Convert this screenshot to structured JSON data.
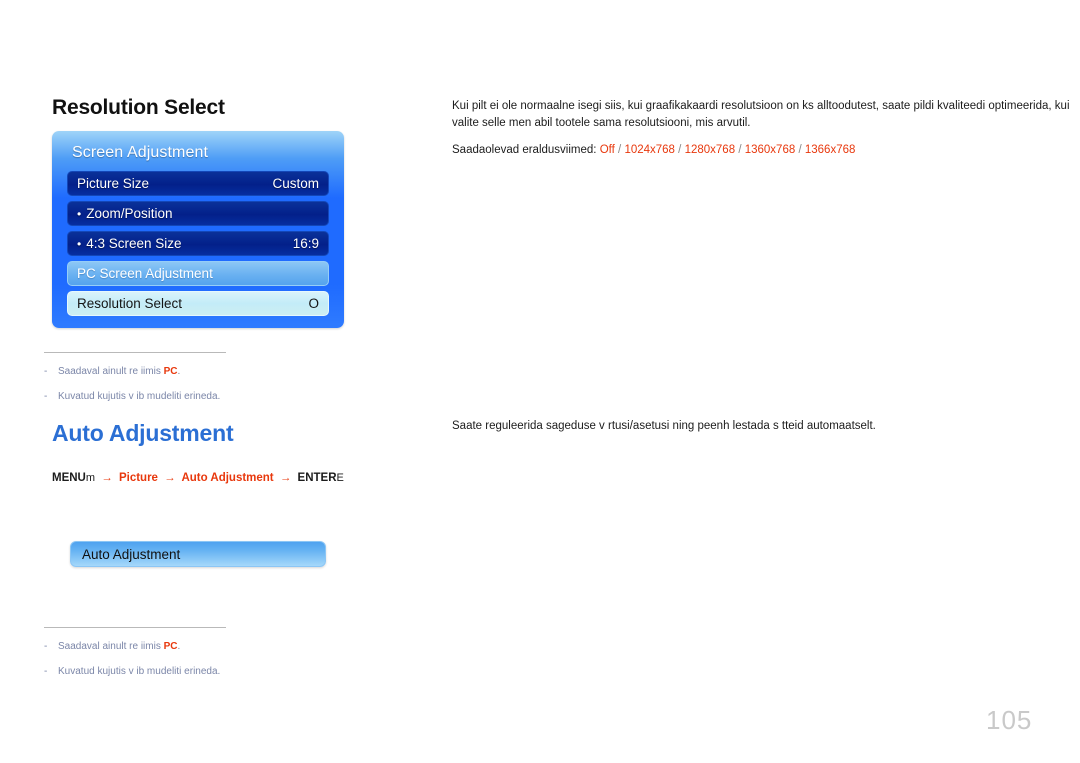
{
  "sections": {
    "resolution_select": {
      "heading": "Resolution Select",
      "description": "Kui pilt ei ole normaalne isegi siis, kui graafikakaardi resolutsioon on  ks alltoodutest, saate pildi kvaliteedi optimeerida, kui valite selle men   abil tootele sama resolutsiooni, mis arvutil.",
      "resolutions_label": "Saadaolevad eraldusviimed:",
      "resolutions": [
        "Off",
        "1024x768",
        "1280x768",
        "1360x768",
        "1366x768"
      ],
      "separator": "/"
    },
    "auto_adjustment": {
      "heading": "Auto Adjustment",
      "description": "Saate reguleerida sageduse v  rtusi/asetusi ning peenh  lestada s tteid automaatselt."
    }
  },
  "breadcrumb": {
    "menu_label": "MENU",
    "menu_key": "m",
    "arrow": "→",
    "step_picture": "Picture",
    "step_auto_adjustment": "Auto Adjustment",
    "enter_label": "ENTER",
    "enter_key": "E"
  },
  "osd_screen_adjustment": {
    "title": "Screen Adjustment",
    "rows": [
      {
        "bullet": "",
        "label": "Picture Size",
        "value": "Custom",
        "style": "dark"
      },
      {
        "bullet": "•",
        "label": "Zoom/Position",
        "value": "",
        "style": "dark"
      },
      {
        "bullet": "•",
        "label": "4:3 Screen Size",
        "value": "16:9",
        "style": "dark"
      },
      {
        "bullet": "",
        "label": "PC Screen Adjustment",
        "value": "",
        "style": "lightblue"
      },
      {
        "bullet": "",
        "label": "Resolution Select",
        "value": "O",
        "style": "pale"
      }
    ]
  },
  "osd_auto_adjustment": {
    "label": "Auto Adjustment"
  },
  "footnotes_top": [
    {
      "dash": "-",
      "text_before": "Saadaval ainult re iimis ",
      "accent": "PC",
      "text_after": "."
    },
    {
      "dash": "-",
      "text_before": "Kuvatud kujutis v ib mudeliti erineda.",
      "accent": "",
      "text_after": ""
    }
  ],
  "footnotes_bottom": [
    {
      "dash": "-",
      "text_before": "Saadaval ainult re iimis ",
      "accent": "PC",
      "text_after": "."
    },
    {
      "dash": "-",
      "text_before": "Kuvatud kujutis v ib mudeliti erineda.",
      "accent": "",
      "text_after": ""
    }
  ],
  "page_number": "105",
  "colors": {
    "accent_red": "#e8380d",
    "heading_blue": "#2b6fd4",
    "panel_blue": "#1f6bff",
    "row_dark": "#042a92",
    "row_pale": "#c3ecf8",
    "footnote_text": "#7b86a8",
    "page_number": "#c9c9c9"
  }
}
